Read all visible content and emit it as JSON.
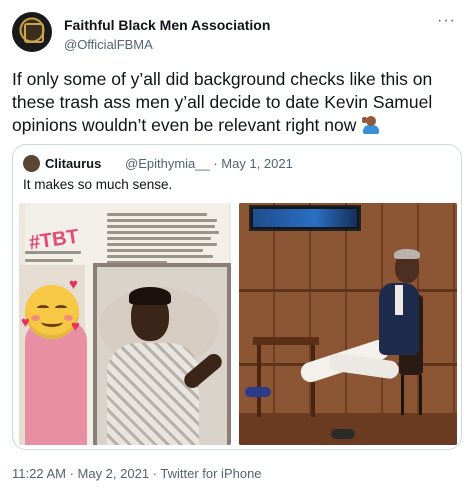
{
  "account": {
    "name": "Faithful Black Men Association",
    "handle": "@OfficialFBMA"
  },
  "more_icon": "more-horizontal-icon",
  "tweet": {
    "text": "If only some of y’all did background checks like this on these trash ass men y’all decide to date Kevin Samuel opinions wouldn’t even be relevant right now",
    "emoji": "man-facepalming-medium-dark-skin-tone"
  },
  "quoted_tweet": {
    "name": "Clitaurus",
    "handle_date": "@Epithymia__ · May 1, 2021",
    "text": "It makes so much sense."
  },
  "media": {
    "left_image": {
      "tbt_label": "#TBT",
      "emoji": "smiling-face-with-hearts"
    },
    "right_image": {}
  },
  "footer": {
    "timestamp": "11:22 AM · May 2, 2021 · Twitter for iPhone"
  },
  "colors": {
    "text_primary": "#0f1419",
    "text_secondary": "#536471",
    "border": "#cfd9de",
    "tbt_pink": "#e34b73"
  }
}
